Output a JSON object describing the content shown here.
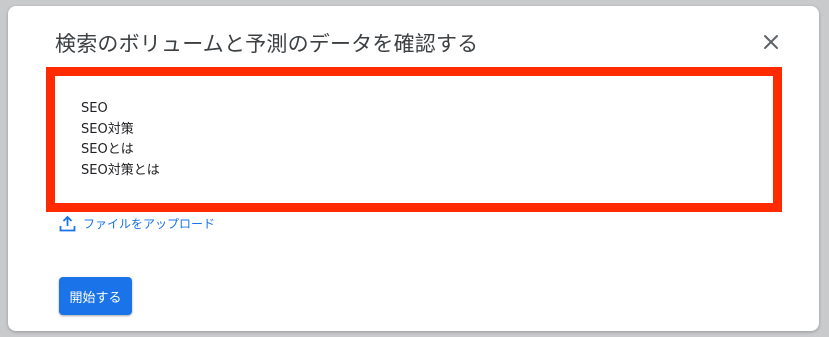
{
  "dialog": {
    "title": "検索のボリュームと予測のデータを確認する",
    "close_icon": "close-icon"
  },
  "keywords": {
    "lines": [
      "SEO",
      "SEO対策",
      "SEOとは",
      "SEO対策とは"
    ],
    "highlight_color": "#ff2a00"
  },
  "upload": {
    "icon": "upload-icon",
    "label": "ファイルをアップロード",
    "color": "#1a73e8"
  },
  "actions": {
    "start_label": "開始する",
    "accent": "#1a73e8"
  }
}
